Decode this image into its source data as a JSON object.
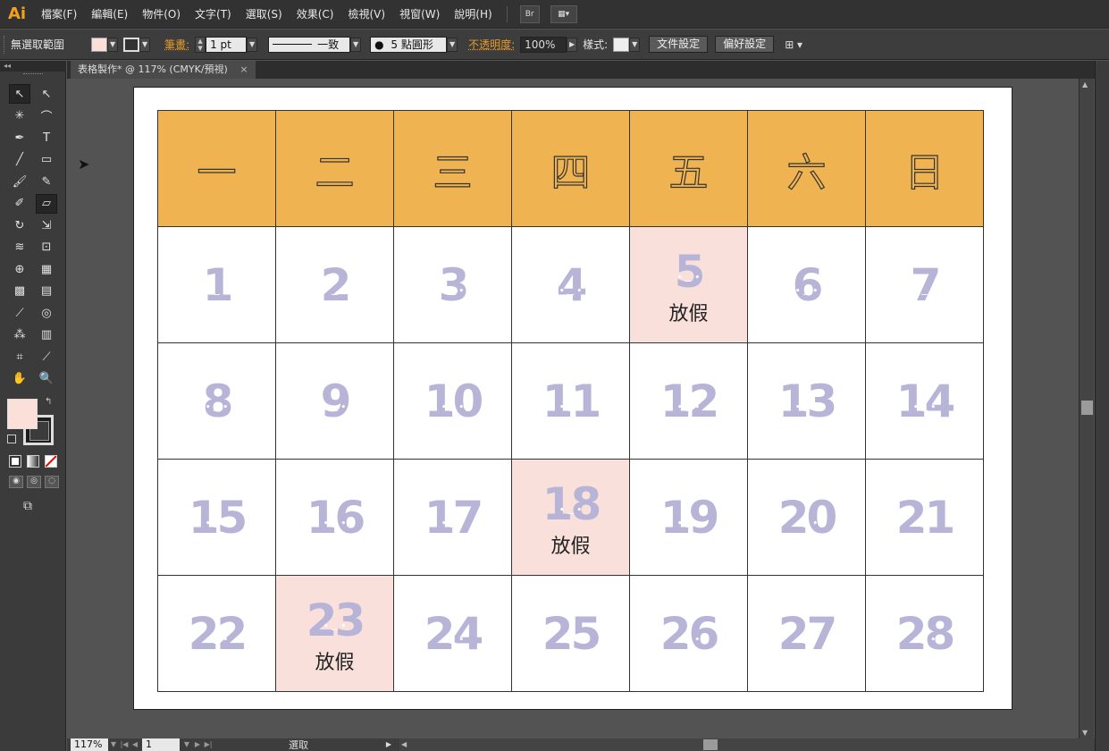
{
  "menubar": {
    "logo": "Ai",
    "items": [
      "檔案(F)",
      "編輯(E)",
      "物件(O)",
      "文字(T)",
      "選取(S)",
      "效果(C)",
      "檢視(V)",
      "視窗(W)",
      "說明(H)"
    ],
    "bridge_label": "Br"
  },
  "controlbar": {
    "selection_status": "無選取範圍",
    "stroke_label": "筆畫:",
    "stroke_weight": "1 pt",
    "stroke_profile": "一致",
    "brush": "5 點圓形",
    "opacity_label": "不透明度:",
    "opacity_value": "100%",
    "style_label": "樣式:",
    "doc_setup_button": "文件設定",
    "preferences_button": "偏好設定",
    "fill_color": "#fbe0da"
  },
  "document": {
    "tab_title": "表格製作* @ 117% (CMYK/預視)",
    "close_glyph": "×"
  },
  "calendar": {
    "weekdays": [
      "一",
      "二",
      "三",
      "四",
      "五",
      "六",
      "日"
    ],
    "holiday_label": "放假",
    "header_color": "#efb451",
    "holiday_color": "#fae0da",
    "number_color": "#b8b4d8",
    "weeks": [
      [
        {
          "d": "1"
        },
        {
          "d": "2"
        },
        {
          "d": "3"
        },
        {
          "d": "4"
        },
        {
          "d": "5",
          "holiday": true
        },
        {
          "d": "6"
        },
        {
          "d": "7"
        }
      ],
      [
        {
          "d": "8"
        },
        {
          "d": "9"
        },
        {
          "d": "10"
        },
        {
          "d": "11"
        },
        {
          "d": "12"
        },
        {
          "d": "13"
        },
        {
          "d": "14"
        }
      ],
      [
        {
          "d": "15"
        },
        {
          "d": "16"
        },
        {
          "d": "17"
        },
        {
          "d": "18",
          "holiday": true
        },
        {
          "d": "19"
        },
        {
          "d": "20"
        },
        {
          "d": "21"
        }
      ],
      [
        {
          "d": "22"
        },
        {
          "d": "23",
          "holiday": true
        },
        {
          "d": "24"
        },
        {
          "d": "25"
        },
        {
          "d": "26"
        },
        {
          "d": "27"
        },
        {
          "d": "28"
        }
      ]
    ]
  },
  "statusbar": {
    "zoom": "117%",
    "page": "1",
    "status_text": "選取"
  },
  "tools": [
    {
      "name": "selection-tool",
      "glyph": "↖"
    },
    {
      "name": "direct-selection-tool",
      "glyph": "↖"
    },
    {
      "name": "magic-wand-tool",
      "glyph": "✳"
    },
    {
      "name": "lasso-tool",
      "glyph": "⌒"
    },
    {
      "name": "pen-tool",
      "glyph": "✒"
    },
    {
      "name": "type-tool",
      "glyph": "T"
    },
    {
      "name": "line-tool",
      "glyph": "╱"
    },
    {
      "name": "rectangle-tool",
      "glyph": "▭"
    },
    {
      "name": "paintbrush-tool",
      "glyph": "🖌"
    },
    {
      "name": "pencil-tool",
      "glyph": "✎"
    },
    {
      "name": "blob-brush-tool",
      "glyph": "✐"
    },
    {
      "name": "eraser-tool",
      "glyph": "▱"
    },
    {
      "name": "rotate-tool",
      "glyph": "↻"
    },
    {
      "name": "scale-tool",
      "glyph": "⇲"
    },
    {
      "name": "warp-tool",
      "glyph": "≋"
    },
    {
      "name": "free-transform-tool",
      "glyph": "⊡"
    },
    {
      "name": "shape-builder-tool",
      "glyph": "⊕"
    },
    {
      "name": "perspective-grid-tool",
      "glyph": "▦"
    },
    {
      "name": "mesh-tool",
      "glyph": "▩"
    },
    {
      "name": "gradient-tool",
      "glyph": "▤"
    },
    {
      "name": "eyedropper-tool",
      "glyph": "⟋"
    },
    {
      "name": "blend-tool",
      "glyph": "◎"
    },
    {
      "name": "symbol-sprayer-tool",
      "glyph": "⁂"
    },
    {
      "name": "column-graph-tool",
      "glyph": "▥"
    },
    {
      "name": "artboard-tool",
      "glyph": "⌗"
    },
    {
      "name": "slice-tool",
      "glyph": "⟋"
    },
    {
      "name": "hand-tool",
      "glyph": "✋"
    },
    {
      "name": "zoom-tool",
      "glyph": "🔍"
    }
  ]
}
